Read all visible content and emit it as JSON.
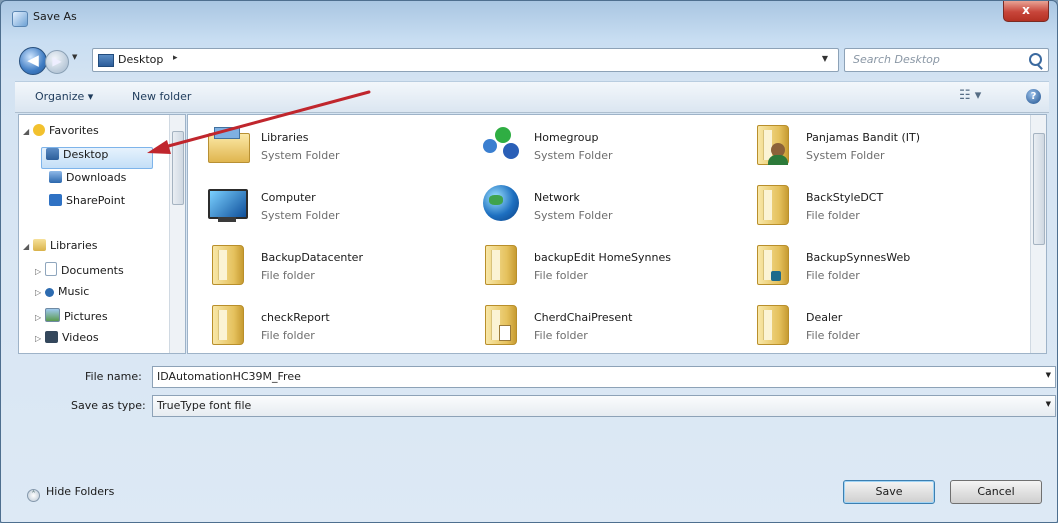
{
  "window": {
    "title": "Save As",
    "close_label": "x"
  },
  "address": {
    "path": "Desktop",
    "separator": "▸",
    "search_placeholder": "Search Desktop"
  },
  "toolbar": {
    "organize": "Organize ▾",
    "new_folder": "New folder",
    "views": "☷ ▾",
    "help": "?"
  },
  "nav": {
    "favorites": "Favorites",
    "desktop": "Desktop",
    "downloads": "Downloads",
    "sharepoint": "SharePoint",
    "libraries": "Libraries",
    "documents": "Documents",
    "music": "Music",
    "pictures": "Pictures",
    "videos": "Videos"
  },
  "items": [
    {
      "name": "Libraries",
      "type": "System Folder",
      "icon": "libraries-icon"
    },
    {
      "name": "Homegroup",
      "type": "System Folder",
      "icon": "homegroup-icon"
    },
    {
      "name": "Panjamas Bandit (IT)",
      "type": "System Folder",
      "icon": "user-folder-icon"
    },
    {
      "name": "Computer",
      "type": "System Folder",
      "icon": "computer-icon"
    },
    {
      "name": "Network",
      "type": "System Folder",
      "icon": "network-icon"
    },
    {
      "name": "BackStyleDCT",
      "type": "File folder",
      "icon": "folder-icon"
    },
    {
      "name": "BackupDatacenter",
      "type": "File folder",
      "icon": "folder-icon"
    },
    {
      "name": "backupEdit HomeSynnes",
      "type": "File folder",
      "icon": "folder-icon"
    },
    {
      "name": "BackupSynnesWeb",
      "type": "File folder",
      "icon": "folder-icon"
    },
    {
      "name": "checkReport",
      "type": "File folder",
      "icon": "folder-icon"
    },
    {
      "name": "CherdChaiPresent",
      "type": "File folder",
      "icon": "folder-icon"
    },
    {
      "name": "Dealer",
      "type": "File folder",
      "icon": "folder-icon"
    }
  ],
  "form": {
    "file_name_label": "File name:",
    "file_name_value": "IDAutomationHC39M_Free",
    "save_type_label": "Save as type:",
    "save_type_value": "TrueType font file"
  },
  "buttons": {
    "hide_folders": "Hide Folders",
    "save": "Save",
    "cancel": "Cancel"
  },
  "colors": {
    "annotation_arrow": "#c0262d",
    "accent": "#3c7fb1"
  }
}
